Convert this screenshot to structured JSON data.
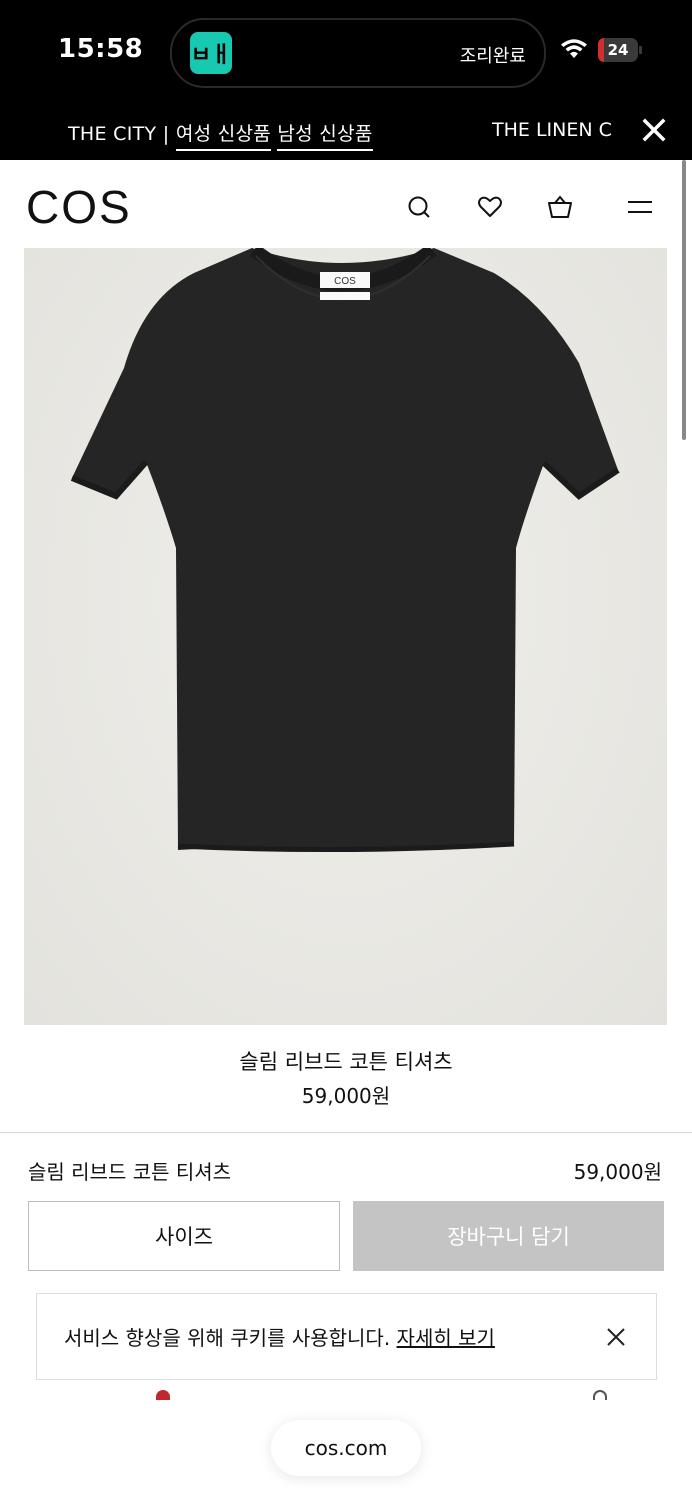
{
  "status_bar": {
    "time": "15:58",
    "island_app_logo": "ㅂㅐ",
    "island_text": "조리완료",
    "battery_level": "24"
  },
  "promo_bar": {
    "text_prefix": "THE CITY | ",
    "link_women": "여성 신상품",
    "link_men": "남성 신상품",
    "text_next": "THE LINEN C"
  },
  "header": {
    "logo": "COS",
    "icons": [
      "search-icon",
      "heart-icon",
      "bag-icon",
      "menu-icon"
    ]
  },
  "product": {
    "name": "슬림 리브드 코튼 티셔츠",
    "price": "59,000원",
    "garment_color": "#222222",
    "label_text": "COS"
  },
  "sticky_bar": {
    "name": "슬림 리브드 코튼 티셔츠",
    "price": "59,000원",
    "size_label": "사이즈",
    "cart_label": "장바구니 담기"
  },
  "cookie_banner": {
    "text": "서비스 향상을 위해 쿠키를 사용합니다. ",
    "link": "자세히 보기"
  },
  "browser": {
    "url": "cos.com"
  }
}
